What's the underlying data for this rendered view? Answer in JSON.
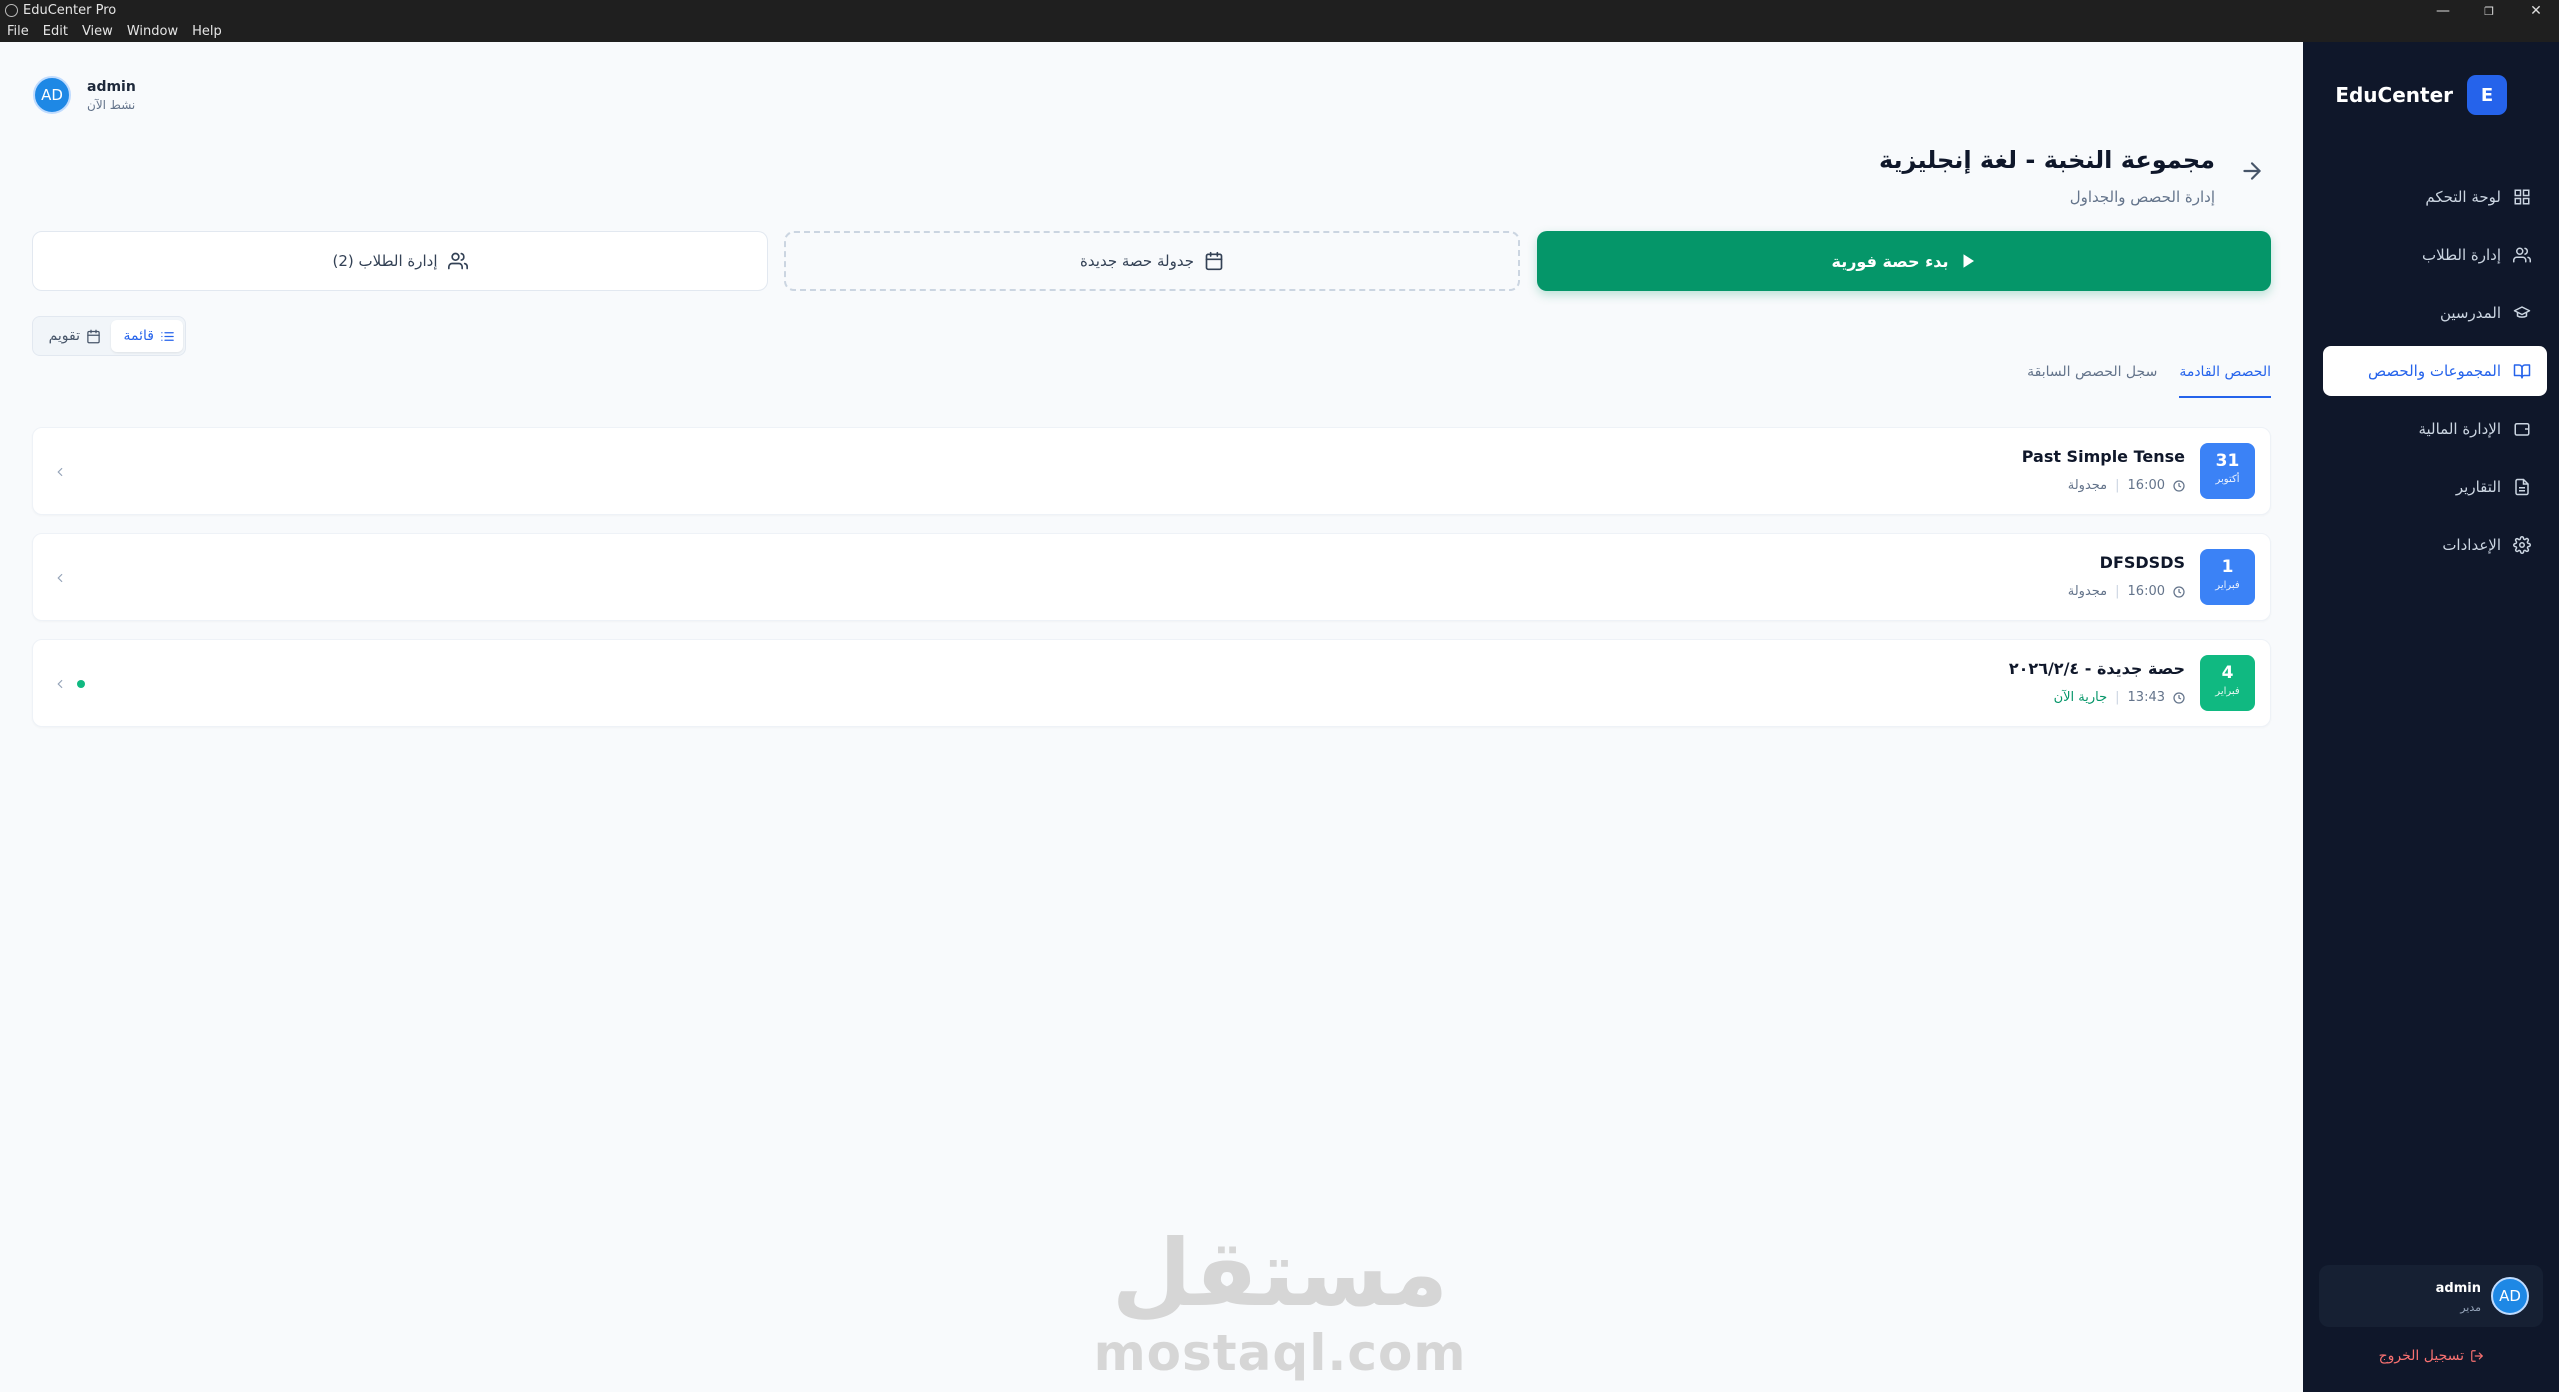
{
  "window": {
    "title": "EduCenter Pro",
    "menu": [
      "File",
      "Edit",
      "View",
      "Window",
      "Help"
    ],
    "controls": {
      "minimize": "—",
      "restore": "❐",
      "close": "✕"
    }
  },
  "header": {
    "user_initials": "AD",
    "user_name": "admin",
    "user_status": "نشط الآن"
  },
  "page": {
    "title": "مجموعة النخبة - لغة إنجليزية",
    "subtitle": "إدارة الحصص والجداول"
  },
  "actions": {
    "start_label": "بدء حصة فورية",
    "schedule_label": "جدولة حصة جديدة",
    "students_label": "إدارة الطلاب (2)"
  },
  "view_toggle": {
    "list_label": "قائمة",
    "calendar_label": "تقويم"
  },
  "tabs": [
    {
      "label": "الحصص القادمة",
      "active": true
    },
    {
      "label": "سجل الحصص السابقة",
      "active": false
    }
  ],
  "sessions": [
    {
      "day": "31",
      "month": "أكتوبر",
      "title": "Past Simple Tense",
      "time": "16:00",
      "state": "مجدولة",
      "color": "#3b82f6"
    },
    {
      "day": "1",
      "month": "فبراير",
      "title": "DFSDSDS",
      "time": "16:00",
      "state": "مجدولة",
      "color": "#3b82f6"
    },
    {
      "day": "4",
      "month": "فبراير",
      "title": "حصة جديدة - ٢٠٢٦/٢/٤",
      "time": "13:43",
      "state": "جارية الآن",
      "color": "#10b981"
    }
  ],
  "sidebar": {
    "brand_letter": "E",
    "brand_name": "EduCenter",
    "items": [
      {
        "label": "لوحة التحكم",
        "icon": "dashboard-icon"
      },
      {
        "label": "إدارة الطلاب",
        "icon": "users-icon"
      },
      {
        "label": "المدرسين",
        "icon": "graduation-cap-icon"
      },
      {
        "label": "المجموعات والحصص",
        "icon": "book-open-icon",
        "active": true
      },
      {
        "label": "الإدارة المالية",
        "icon": "wallet-icon"
      },
      {
        "label": "التقارير",
        "icon": "file-text-icon"
      },
      {
        "label": "الإعدادات",
        "icon": "gear-icon"
      }
    ],
    "user_initials": "AD",
    "user_name": "admin",
    "user_role": "مدير",
    "logout_label": "تسجيل الخروج"
  },
  "watermark": {
    "arabic": "مستقل",
    "latin": "mostaql.com"
  },
  "colors": {
    "accent": "#2563eb",
    "success": "#059669",
    "sidebar_bg": "#0f172a"
  }
}
